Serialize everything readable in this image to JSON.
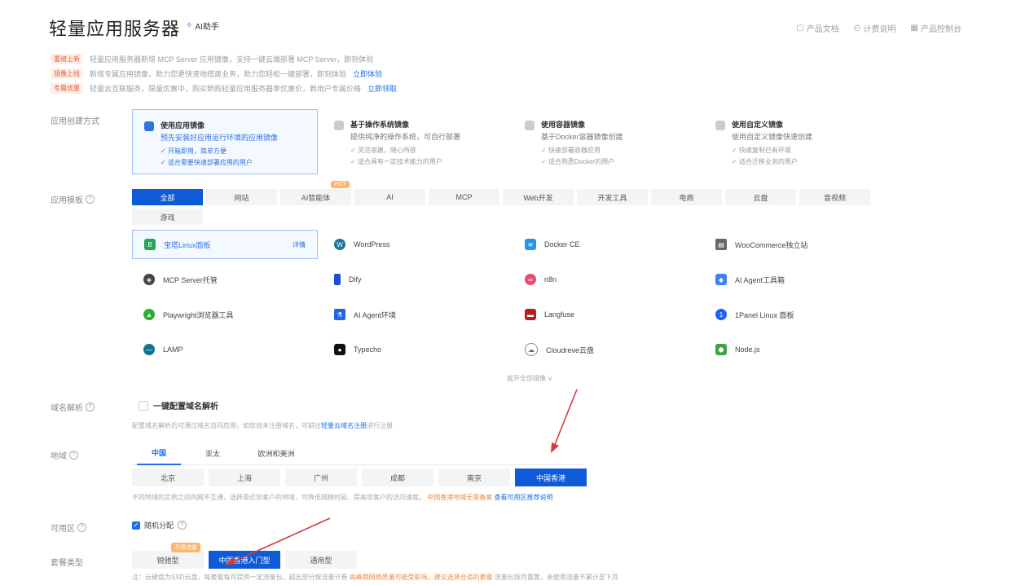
{
  "header": {
    "title": "轻量应用服务器",
    "ai_badge": "AI助手",
    "links": [
      "产品文档",
      "计费说明",
      "产品控制台"
    ]
  },
  "notices": [
    {
      "tag": "重磅上新",
      "text": "轻量应用服务器新增 MCP Server 应用镜像，支持一键云端部署 MCP Server，即刻体验",
      "link": ""
    },
    {
      "tag": "镜像上线",
      "text": "新增专属应用镜像，助力您更快速地搭建业务，助力您轻松一键部署，即刻体验",
      "link": "立即体验"
    },
    {
      "tag": "专属优惠",
      "text": "轻量云互联服务，限量优惠中，购买新购轻量应用服务器享优惠价，新用户专属价格",
      "link": "立即领取"
    }
  ],
  "creation": {
    "label": "应用创建方式",
    "methods": [
      {
        "title": "使用应用镜像",
        "desc": "预先安装好应用运行环境的应用镜像",
        "lines": [
          "开箱即用，简单方便",
          "适合需要快速部署应用的用户"
        ],
        "selected": true
      },
      {
        "title": "基于操作系统镜像",
        "desc": "提供纯净的操作系统，可自行部署",
        "lines": [
          "灵活搭建，随心所欲",
          "适合具有一定技术能力的用户"
        ],
        "selected": false
      },
      {
        "title": "使用容器镜像",
        "desc": "基于Docker容器镜像创建",
        "lines": [
          "快速部署容器应用",
          "适合熟悉Docker的用户"
        ],
        "selected": false
      },
      {
        "title": "使用自定义镜像",
        "desc": "使用自定义镜像快速创建",
        "lines": [
          "快速复制已有环境",
          "适合迁移业务的用户"
        ],
        "selected": false
      }
    ]
  },
  "categories": {
    "label": "应用模板",
    "items": [
      "全部",
      "网站",
      "AI智能体",
      "AI",
      "MCP",
      "Web开发",
      "开发工具",
      "电商",
      "云盘",
      "音视频",
      "游戏"
    ],
    "active_index": 0,
    "hot_index": 2,
    "hot_label": "HOT"
  },
  "apps": {
    "items": [
      {
        "name": "宝塔Linux面板",
        "icon": "bt-panel-icon",
        "selected": true,
        "detail": "详情"
      },
      {
        "name": "WordPress",
        "icon": "wordpress-icon"
      },
      {
        "name": "Docker CE",
        "icon": "docker-icon"
      },
      {
        "name": "WooCommerce独立站",
        "icon": "woocommerce-icon"
      },
      {
        "name": "MCP Server托管",
        "icon": "mcp-icon"
      },
      {
        "name": "Dify",
        "icon": "dify-icon"
      },
      {
        "name": "n8n",
        "icon": "n8n-icon"
      },
      {
        "name": "AI Agent工具箱",
        "icon": "ai-agent-box-icon"
      },
      {
        "name": "Playwright浏览器工具",
        "icon": "playwright-icon"
      },
      {
        "name": "AI Agent环境",
        "icon": "ai-agent-env-icon"
      },
      {
        "name": "Langfuse",
        "icon": "langfuse-icon"
      },
      {
        "name": "1Panel Linux 面板",
        "icon": "onepanel-icon"
      },
      {
        "name": "LAMP",
        "icon": "lamp-icon"
      },
      {
        "name": "Typecho",
        "icon": "typecho-icon"
      },
      {
        "name": "Cloudreve云盘",
        "icon": "cloudreve-icon"
      },
      {
        "name": "Node.js",
        "icon": "nodejs-icon"
      }
    ],
    "more": "展开全部镜像 ∨"
  },
  "domain": {
    "label": "域名解析",
    "option": "一键配置域名解析",
    "note": "配置域名解析后可通过域名访问应用，如您尚未注册域名，可前往",
    "link": "轻量云域名注册",
    "note_after": "进行注册"
  },
  "region": {
    "label": "地域",
    "tabs": [
      "中国",
      "亚太",
      "欧洲和美洲"
    ],
    "active_tab": 0,
    "chips": [
      "北京",
      "上海",
      "广州",
      "成都",
      "南京",
      "中国香港"
    ],
    "active_chip": 5,
    "note": "不同地域的实例之间内网不互通，选择靠近您客户的地域，可降低网络时延、提高您客户的访问速度。",
    "note_warn": "中国香港地域无需备案",
    "link": "查看可用区推荐说明"
  },
  "zone": {
    "label": "可用区",
    "option": "随机分配"
  },
  "package": {
    "label": "套餐类型",
    "chips": [
      "锐驰型",
      "中国香港入门型",
      "通用型"
    ],
    "active_index": 1,
    "badge": "不限流量",
    "note": "注：云硬盘为SSD云盘，每套餐每月提供一定流量包，超出部分按流量计费",
    "note_warn": "高峰期网络质量可能受影响，建议选择合适的套餐",
    "note_tail": "流量包按月重置，未使用流量不累计至下月"
  },
  "colors": {
    "primary": "#0f5ad6",
    "link": "#1b6fe8",
    "annotation": "#d43a3a"
  }
}
